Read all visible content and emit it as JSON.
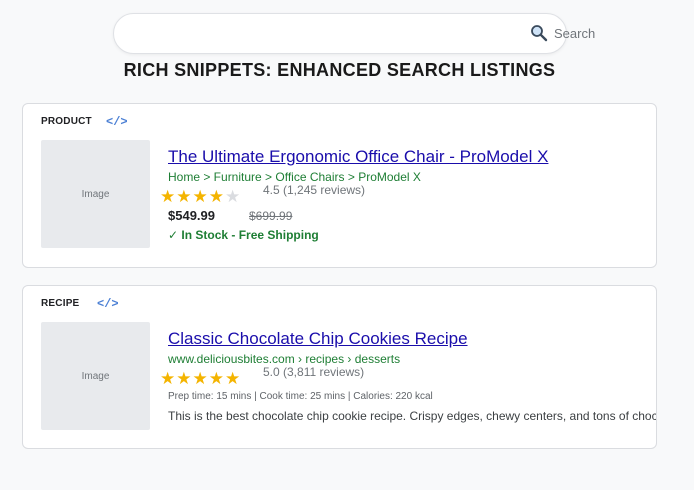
{
  "search": {
    "value": "",
    "label": "Search"
  },
  "page_title": "RICH SNIPPETS: ENHANCED SEARCH LISTINGS",
  "code_icon_glyph": "</>",
  "cards": [
    {
      "type": "PRODUCT",
      "image_label": "Image",
      "title": "The Ultimate Ergonomic Office Chair - ProModel X",
      "breadcrumb": "Home > Furniture > Office Chairs > ProModel X",
      "rating": {
        "value": 4.5,
        "filled_stars": 4,
        "total_stars": 5,
        "text": "4.5 (1,245 reviews)"
      },
      "price": "$549.99",
      "old_price": "$699.99",
      "stock": "✓ In Stock - Free Shipping"
    },
    {
      "type": "RECIPE",
      "image_label": "Image",
      "title": "Classic Chocolate Chip Cookies Recipe",
      "breadcrumb": "www.deliciousbites.com › recipes › desserts",
      "rating": {
        "value": 5.0,
        "filled_stars": 5,
        "total_stars": 5,
        "text": "5.0 (3,811 reviews)"
      },
      "meta": "Prep time: 15 mins | Cook time: 25 mins | Calories: 220 kcal",
      "description": "This is the best chocolate chip cookie recipe. Crispy edges, chewy centers, and tons of chocolate"
    }
  ],
  "colors": {
    "link": "#1a0dab",
    "green": "#1e7e34",
    "star": "#f4b400",
    "code_icon": "#4a7fd4"
  }
}
